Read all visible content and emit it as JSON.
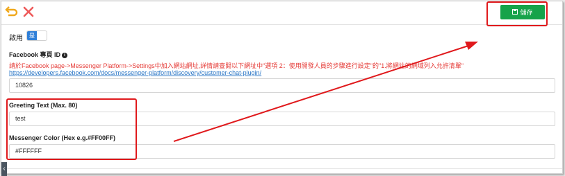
{
  "toolbar": {
    "undo_icon": "undo-arrow-icon",
    "close_icon": "close-x-icon",
    "save_icon": "floppy-disk-icon",
    "save_label": "儲存"
  },
  "enable": {
    "label": "啟用",
    "toggle_value": "是"
  },
  "facebook_page": {
    "label": "Facebook 專頁 ID",
    "note": "請於Facebook page->Messenger Platform->Settings中加入網站網址,詳情請查閱以下網址中\"選項 2：使用開發人員的步驟進行設定\"的\"1.將網站的網域列入允許清單\"",
    "link": "https://developers.facebook.com/docs/messenger-platform/discovery/customer-chat-plugin/",
    "value": "10826"
  },
  "greeting": {
    "label": "Greeting Text (Max. 80)",
    "value": "test"
  },
  "color": {
    "label": "Messenger Color (Hex e.g.#FF00FF)",
    "value": "#FFFFFF"
  },
  "colors": {
    "accent_green": "#16a34a",
    "annotation_red": "#e0191c",
    "link_blue": "#2a76c6",
    "toggle_blue": "#2f7fd8"
  }
}
